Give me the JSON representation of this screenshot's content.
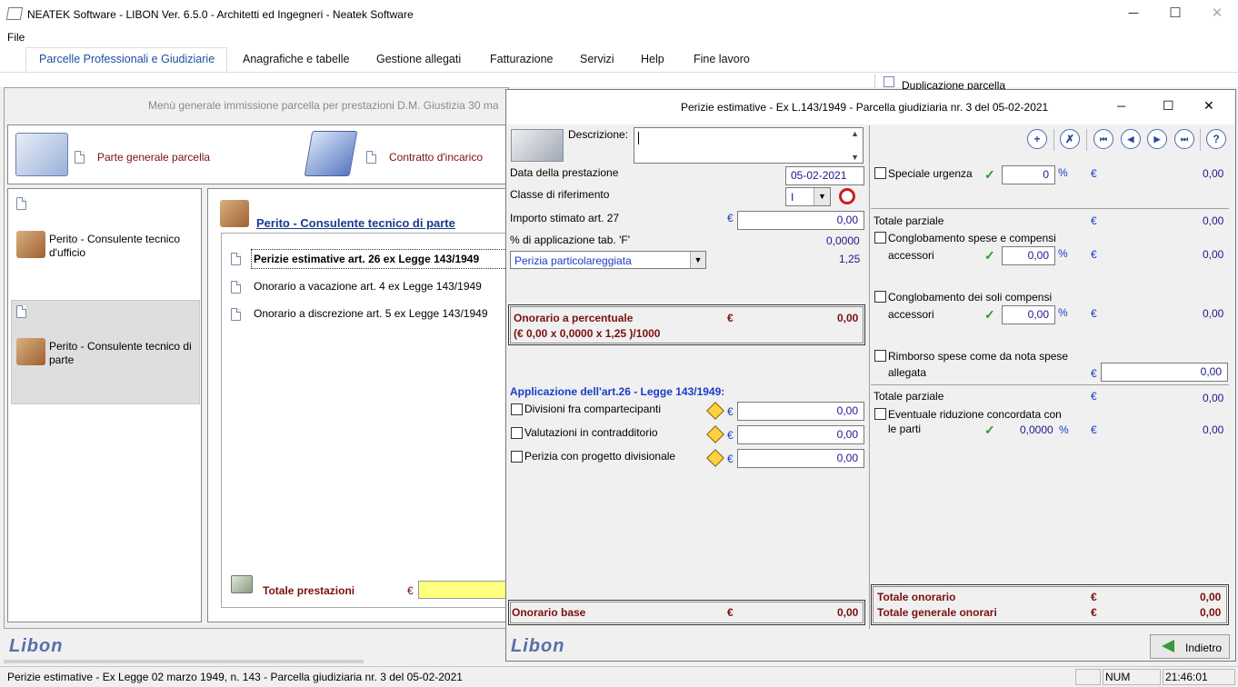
{
  "window": {
    "title": "NEATEK Software - LIBON Ver. 6.5.0 - Architetti ed Ingegneri - Neatek Software",
    "min": "─",
    "max": "☐",
    "close": "✕"
  },
  "menu": {
    "file": "File"
  },
  "ribbon": {
    "tabs": [
      "Parcelle Professionali e Giudiziarie",
      "Anagrafiche e tabelle",
      "Gestione allegati",
      "Fatturazione",
      "Servizi",
      "Help",
      "Fine lavoro"
    ],
    "duplicazione": "Duplicazione parcella"
  },
  "back": {
    "header": "Menù generale immissione parcella per prestazioni D.M. Giustizia 30 ma",
    "parte_generale": "Parte generale parcella",
    "contratto": "Contratto d'incarico",
    "left_items": [
      "Perito - Consulente tecnico d'ufficio",
      "Perito - Consulente tecnico di parte"
    ],
    "mid_title": "Perito - Consulente tecnico di parte",
    "mid_items": [
      "Perizie estimative art. 26 ex Legge 143/1949",
      "Onorario a vacazione art. 4 ex Legge 143/1949",
      "Onorario a discrezione art. 5 ex Legge 143/1949"
    ],
    "totale_prestazioni": "Totale prestazioni",
    "euro": "€",
    "logo": "Libon"
  },
  "dialog": {
    "title": "Perizie estimative - Ex L.143/1949 - Parcella giudiziaria nr. 3  del 05-02-2021",
    "min": "─",
    "max": "☐",
    "close": "✕",
    "descrizione_label": "Descrizione:",
    "descrizione_value": "",
    "data_label": "Data della prestazione",
    "data_value": "05-02-2021",
    "classe_label": "Classe di riferimento",
    "classe_value": "I",
    "importo_label": "Importo stimato art. 27",
    "importo_value": "0,00",
    "perc_label": "% di applicazione tab. 'F'",
    "perc_value": "0,0000",
    "perizia_select": "Perizia particolareggiata",
    "perizia_coeff": "1,25",
    "onorario_perc_label": "Onorario a percentuale",
    "onorario_perc_value": "0,00",
    "onorario_formula": "(€ 0,00 x 0,0000 x 1,25 )/1000",
    "applicazione_title": "Applicazione dell'art.26 - Legge 143/1949:",
    "divisioni_label": "Divisioni fra compartecipanti",
    "divisioni_value": "0,00",
    "valutazioni_label": "Valutazioni in contradditorio",
    "valutazioni_value": "0,00",
    "progetto_label": "Perizia con progetto divisionale",
    "progetto_value": "0,00",
    "onorario_base_label": "Onorario base",
    "onorario_base_value": "0,00",
    "speciale_label": "Speciale urgenza",
    "speciale_perc": "0",
    "speciale_value": "0,00",
    "totale_parziale_label": "Totale parziale",
    "totale_parziale1": "0,00",
    "congl_spese_label1": "Conglobamento spese e compensi",
    "congl_spese_label2": "accessori",
    "congl_spese_perc": "0,00",
    "congl_spese_value": "0,00",
    "congl_soli_label1": "Conglobamento dei soli compensi",
    "congl_soli_label2": "accessori",
    "congl_soli_perc": "0,00",
    "congl_soli_value": "0,00",
    "rimborso_label1": "Rimborso spese come da nota spese",
    "rimborso_label2": "allegata",
    "rimborso_value": "0,00",
    "totale_parziale2": "0,00",
    "riduzione_label1": "Eventuale riduzione concordata con",
    "riduzione_label2": "le parti",
    "riduzione_perc": "0,0000",
    "riduzione_value": "0,00",
    "totale_onorario_label": "Totale onorario",
    "totale_onorario_value": "0,00",
    "totale_generale_label": "Totale generale onorari",
    "totale_generale_value": "0,00",
    "indietro": "Indietro",
    "euro": "€",
    "percent": "%",
    "logo": "Libon"
  },
  "status": {
    "text": "Perizie estimative - Ex Legge 02 marzo 1949, n. 143 - Parcella giudiziaria nr. 3  del 05-02-2021",
    "num": "NUM",
    "time": "21:46:01"
  }
}
